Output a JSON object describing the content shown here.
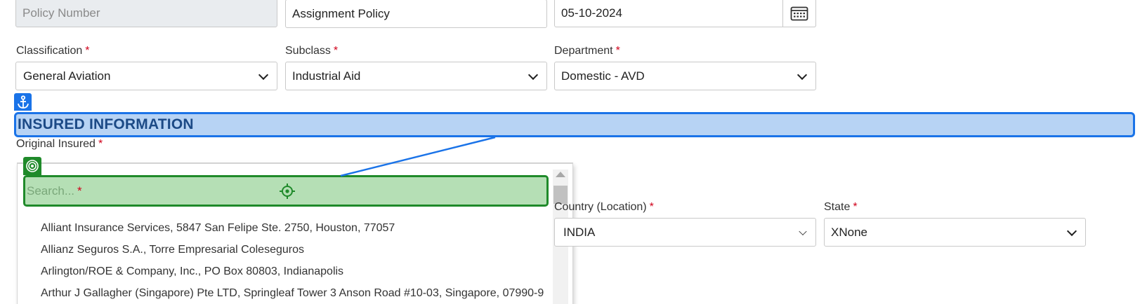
{
  "top_row": {
    "policy_number_placeholder": "Policy Number",
    "policy_type_value": "Assignment Policy",
    "date_value": "05-10-2024"
  },
  "classification": {
    "label": "Classification",
    "value": "General Aviation"
  },
  "subclass": {
    "label": "Subclass",
    "value": "Industrial Aid"
  },
  "department": {
    "label": "Department",
    "value": "Domestic - AVD"
  },
  "required_mark": "*",
  "section": {
    "title": "INSURED INFORMATION"
  },
  "original_insured": {
    "label": "Original Insured",
    "search_placeholder": "Search...",
    "options": [
      "Alliant Insurance Services, 5847 San Felipe Ste. 2750, Houston, 77057",
      "Allianz Seguros S.A., Torre Empresarial Coleseguros",
      "Arlington/ROE & Company, Inc., PO Box 80803, Indianapolis",
      "Arthur J Gallagher (Singapore) Pte LTD, Springleaf Tower 3 Anson Road #10-03, Singapore, 07990-9"
    ]
  },
  "country": {
    "label": "Country (Location)",
    "value": "INDIA"
  },
  "state": {
    "label": "State",
    "value": "XNone"
  },
  "icons": {
    "calendar": "calendar-icon",
    "anchor": "anchor-icon",
    "target": "target-icon",
    "crosshair": "crosshair-icon"
  },
  "colors": {
    "highlight_blue": "#1a73e8",
    "highlight_blue_fill": "#b7d3f4",
    "highlight_green": "#1f8a2a",
    "highlight_green_fill": "#b5dfb5",
    "required_red": "#d0021b"
  }
}
